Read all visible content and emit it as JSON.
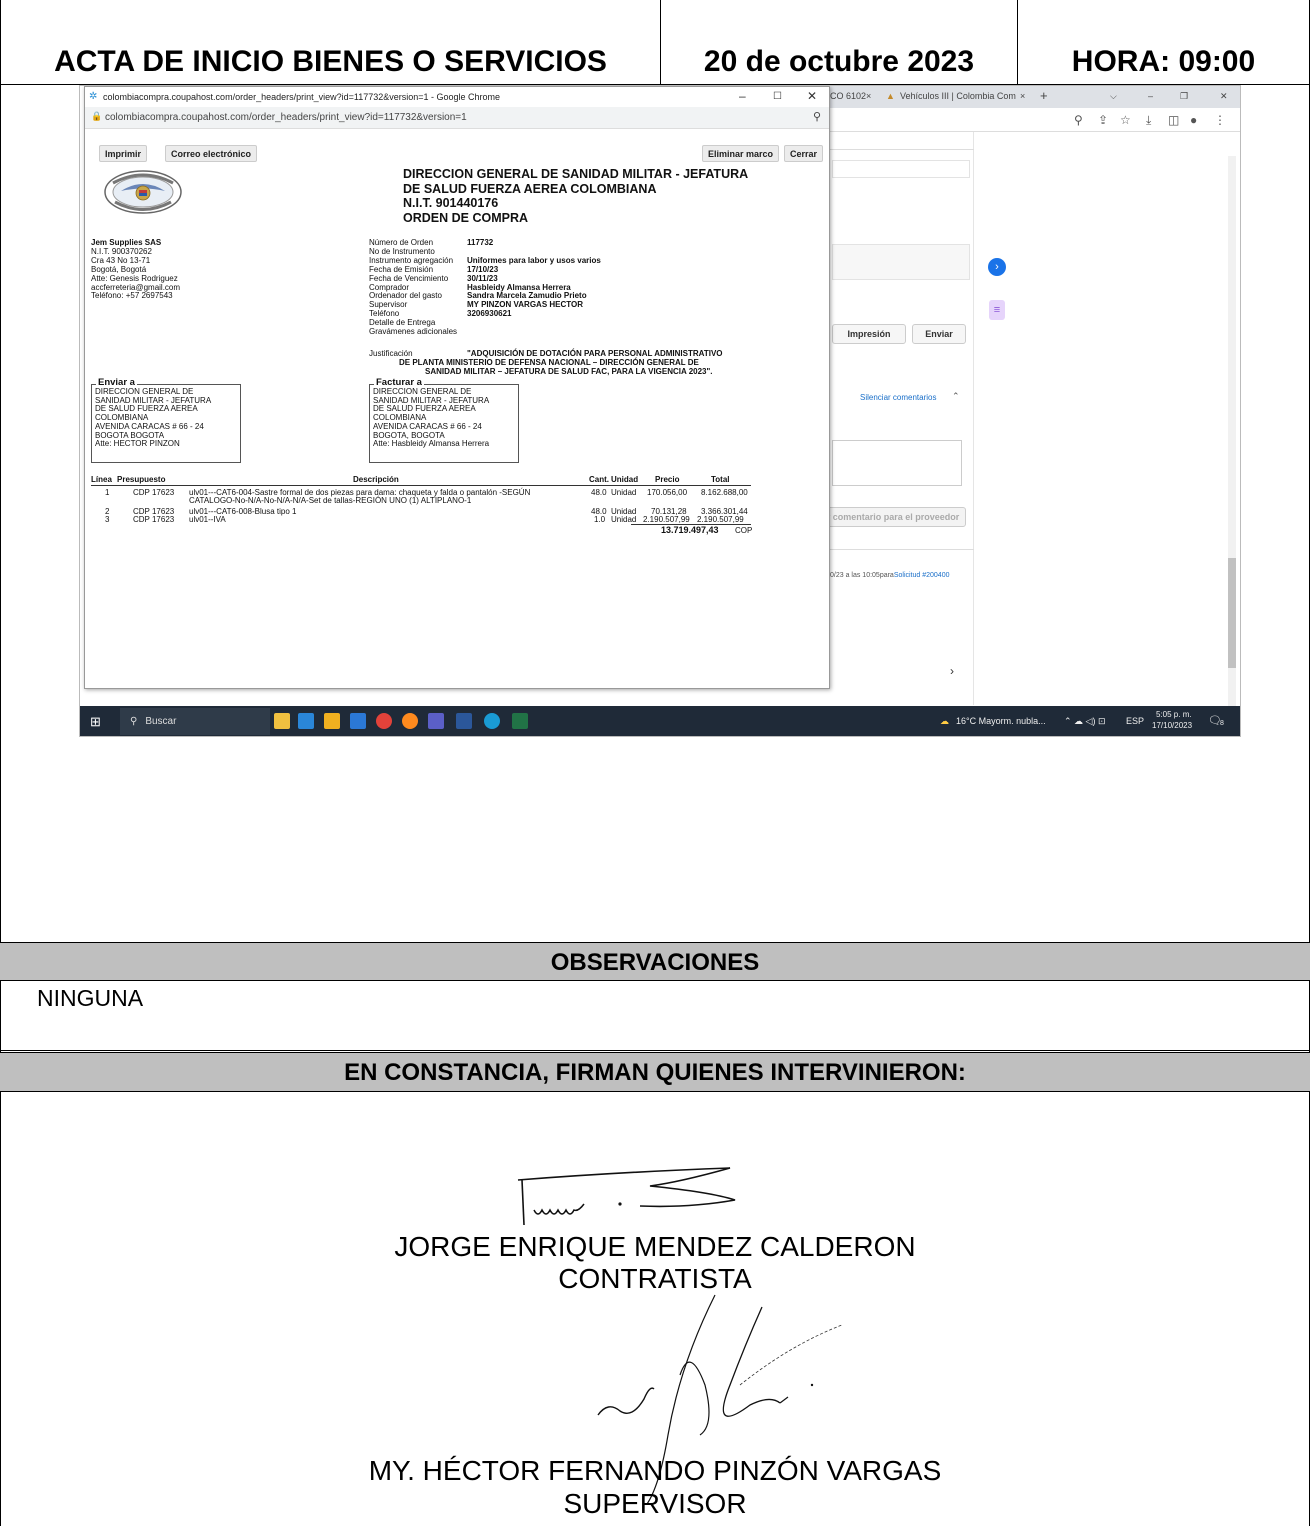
{
  "header": {
    "title": "ACTA DE INICIO BIENES O SERVICIOS",
    "date": "20 de octubre 2023",
    "time": "HORA: 09:00"
  },
  "screenshot": {
    "popup_title": "colombiacompra.coupahost.com/order_headers/print_view?id=117732&version=1 - Google Chrome",
    "popup_url": "colombiacompra.coupahost.com/order_headers/print_view?id=117732&version=1",
    "buttons": {
      "print": "Imprimir",
      "email": "Correo electrónico",
      "remove_frame": "Eliminar marco",
      "close": "Cerrar"
    },
    "org_lines": [
      "DIRECCION GENERAL DE SANIDAD MILITAR - JEFATURA",
      "DE SALUD FUERZA AEREA COLOMBIANA",
      "N.I.T. 901440176",
      "ORDEN DE COMPRA"
    ],
    "vendor": {
      "name": "Jem Supplies SAS",
      "lines": [
        "N.I.T. 900370262",
        "Cra 43 No 13-71",
        "Bogotá, Bogotá",
        "Atte: Genesis Rodriguez",
        "accferreteria@gmail.com",
        "Teléfono: +57 2697543"
      ]
    },
    "order_fields": [
      {
        "k": "Número de Orden",
        "v": "117732"
      },
      {
        "k": "No de Instrumento",
        "v": ""
      },
      {
        "k": "Instrumento agregación",
        "v": "Uniformes para labor y usos varios"
      },
      {
        "k": "Fecha de Emisión",
        "v": "17/10/23"
      },
      {
        "k": "Fecha de Vencimiento",
        "v": "30/11/23"
      },
      {
        "k": "Comprador",
        "v": "Hasbleidy Almansa Herrera"
      },
      {
        "k": "Ordenador del gasto",
        "v": "Sandra Marcela Zamudio Prieto"
      },
      {
        "k": "Supervisor",
        "v": "MY PINZON VARGAS HECTOR"
      },
      {
        "k": "Teléfono",
        "v": "3206930621"
      },
      {
        "k": "Detalle de Entrega",
        "v": ""
      },
      {
        "k": "Gravámenes adicionales",
        "v": ""
      }
    ],
    "justification_label": "Justificación",
    "justification_lines": [
      "\"ADQUISICIÓN DE DOTACIÓN PARA PERSONAL ADMINISTRATIVO",
      "DE PLANTA MINISTERIO DE DEFENSA NACIONAL – DIRECCIÓN GENERAL DE",
      "SANIDAD MILITAR – JEFATURA DE SALUD FAC, PARA LA VIGENCIA 2023\"."
    ],
    "ship_to": {
      "legend": "Enviar a",
      "lines": [
        "DIRECCION GENERAL DE",
        "SANIDAD MILITAR - JEFATURA",
        "DE SALUD FUERZA AEREA",
        "COLOMBIANA",
        "AVENIDA CARACAS # 66 - 24",
        "BOGOTA BOGOTA",
        "Atte: HECTOR PINZON"
      ]
    },
    "bill_to": {
      "legend": "Facturar a",
      "lines": [
        "DIRECCION GENERAL DE",
        "SANIDAD MILITAR - JEFATURA",
        "DE SALUD FUERZA AEREA",
        "COLOMBIANA",
        "AVENIDA CARACAS # 66 - 24",
        "BOGOTA, BOGOTA",
        "Atte: Hasbleidy Almansa Herrera"
      ]
    },
    "table_headers": [
      "Línea",
      "Presupuesto",
      "Descripción",
      "Cant.",
      "Unidad",
      "Precio",
      "Total"
    ],
    "rows": [
      {
        "line": "1",
        "budget": "CDP 17623",
        "desc1": "ulv01---CAT6-004-Sastre formal de dos piezas para dama: chaqueta y falda o pantalón -SEGÚN",
        "desc2": "CATALOGO-No-N/A-No-N/A-N/A-Set de tallas-REGIÓN UNO (1) ALTIPLANO-1",
        "qty": "48.0",
        "unit": "Unidad",
        "price": "170.056,00",
        "total": "8.162.688,00"
      },
      {
        "line": "2",
        "budget": "CDP 17623",
        "desc1": "ulv01---CAT6-008-Blusa tipo 1",
        "desc2": "",
        "qty": "48.0",
        "unit": "Unidad",
        "price": "70.131,28",
        "total": "3.366.301,44"
      },
      {
        "line": "3",
        "budget": "CDP 17623",
        "desc1": "ulv01--IVA",
        "desc2": "",
        "qty": "1.0",
        "unit": "Unidad",
        "price": "2.190.507,99",
        "total": "2.190.507,99"
      }
    ],
    "grand_total": "13.719.497,43",
    "currency": "COP",
    "background": {
      "tab1": "CO 6102",
      "tab2": "Vehículos III | Colombia Com",
      "print_btn": "Impresión",
      "send_btn": "Enviar",
      "mute_comments": "Silenciar comentarios",
      "comment_btn": "r comentario para el proveedor",
      "log_text": "0/23 a las 10:05para",
      "log_link": "Solicitud #200400"
    },
    "taskbar": {
      "search": "Buscar",
      "weather": "16°C  Mayorm. nubla...",
      "lang": "ESP",
      "time": "5:05 p. m.",
      "date": "17/10/2023",
      "notif": "8"
    }
  },
  "observaciones": {
    "title": "OBSERVACIONES",
    "text": "NINGUNA"
  },
  "firmas": {
    "title": "EN CONSTANCIA,  FIRMAN QUIENES INTERVINIERON:",
    "signer1_name": "JORGE ENRIQUE MENDEZ CALDERON",
    "signer1_role": "CONTRATISTA",
    "signer2_name": "MY. HÉCTOR FERNANDO PINZÓN VARGAS",
    "signer2_role": "SUPERVISOR"
  }
}
